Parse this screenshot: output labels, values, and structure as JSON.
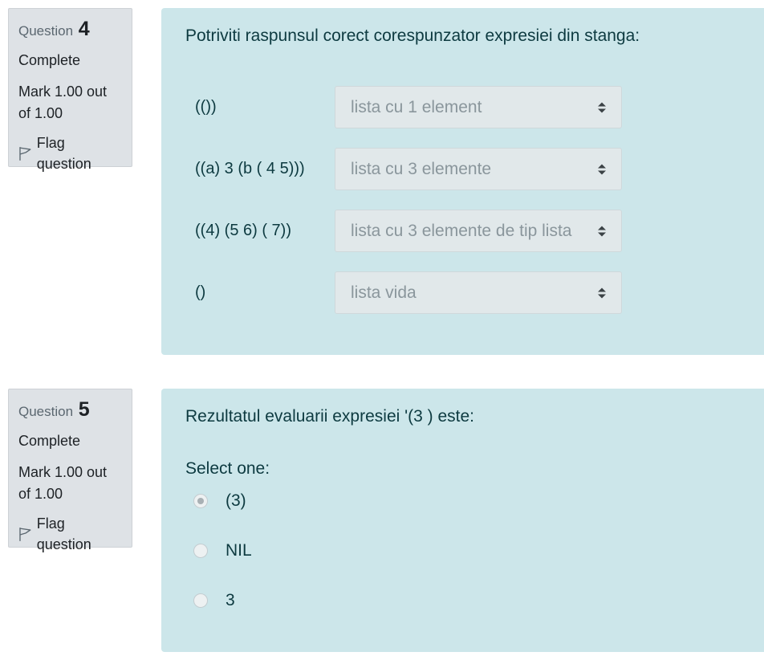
{
  "questions": [
    {
      "label": "Question",
      "number": "4",
      "state": "Complete",
      "grade": "Mark 1.00 out of 1.00",
      "flag": "Flag question",
      "text": "Potriviti raspunsul corect corespunzator expresiei din stanga:",
      "matches": [
        {
          "expr": "(())",
          "selected": "lista cu 1 element"
        },
        {
          "expr": "((a) 3 (b ( 4 5)))",
          "selected": "lista cu 3 elemente"
        },
        {
          "expr": "((4) (5 6) ( 7))",
          "selected": "lista cu 3 elemente de tip lista"
        },
        {
          "expr": "()",
          "selected": "lista vida"
        }
      ]
    },
    {
      "label": "Question",
      "number": "5",
      "state": "Complete",
      "grade": "Mark 1.00 out of 1.00",
      "flag": "Flag question",
      "text": "Rezultatul evaluarii expresiei '(3 ) este:",
      "prompt": "Select one:",
      "options": [
        {
          "label": "(3)",
          "checked": true
        },
        {
          "label": "NIL",
          "checked": false
        },
        {
          "label": "3",
          "checked": false
        }
      ]
    }
  ],
  "colors": {
    "info_bg": "#dee2e6",
    "content_bg": "#cce6ea",
    "select_bg": "#e1e8ea",
    "text_dark": "#0d3a40"
  },
  "icons": {
    "flag": "flag-icon",
    "select_arrows": "sort-arrows-icon"
  }
}
